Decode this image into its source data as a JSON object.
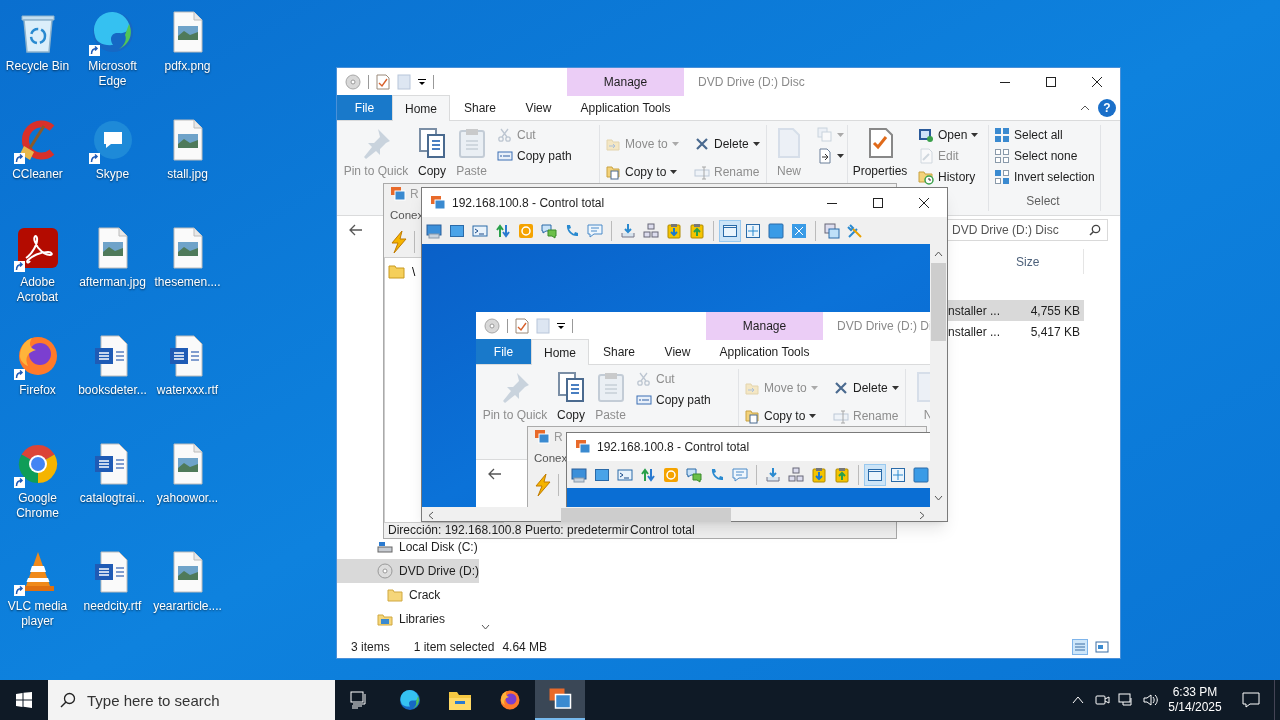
{
  "desktop_icons": [
    {
      "label": "Recycle Bin",
      "kind": "recycle-bin",
      "shortcut": false
    },
    {
      "label": "CCleaner",
      "kind": "ccleaner",
      "shortcut": true
    },
    {
      "label": "Adobe Acrobat",
      "kind": "acrobat",
      "shortcut": true
    },
    {
      "label": "Firefox",
      "kind": "firefox",
      "shortcut": true
    },
    {
      "label": "Google Chrome",
      "kind": "chrome",
      "shortcut": true
    },
    {
      "label": "VLC media player",
      "kind": "vlc",
      "shortcut": true
    },
    {
      "label": "Microsoft Edge",
      "kind": "edge",
      "shortcut": true
    },
    {
      "label": "Skype",
      "kind": "skype",
      "shortcut": true
    },
    {
      "label": "afterman.jpg",
      "kind": "image-file",
      "shortcut": false
    },
    {
      "label": "booksdeter...",
      "kind": "word-file",
      "shortcut": false
    },
    {
      "label": "catalogtrai...",
      "kind": "word-file",
      "shortcut": false
    },
    {
      "label": "needcity.rtf",
      "kind": "word-file",
      "shortcut": false
    },
    {
      "label": "pdfx.png",
      "kind": "image-file",
      "shortcut": false
    },
    {
      "label": "stall.jpg",
      "kind": "image-file",
      "shortcut": false
    },
    {
      "label": "thesemen....",
      "kind": "image-file",
      "shortcut": false
    },
    {
      "label": "waterxxx.rtf",
      "kind": "word-file",
      "shortcut": false
    },
    {
      "label": "yahoowor...",
      "kind": "image-file",
      "shortcut": false
    },
    {
      "label": "yeararticle....",
      "kind": "image-file",
      "shortcut": false
    }
  ],
  "explorer": {
    "context_tab": "Manage",
    "title": "DVD Drive (D:) Disc",
    "tabs": [
      {
        "label": "File",
        "kind": "menu",
        "selected": false
      },
      {
        "label": "Home",
        "kind": "tab",
        "selected": true
      },
      {
        "label": "Share",
        "kind": "tab",
        "selected": false
      },
      {
        "label": "View",
        "kind": "tab",
        "selected": false
      },
      {
        "label": "Application Tools",
        "kind": "tab",
        "selected": false
      }
    ],
    "help": "?",
    "ribbon_groups": [
      {
        "columns": [
          {
            "kind": "large",
            "items": [
              {
                "label": "Pin to Quick",
                "kind": "pin",
                "disabled": true
              }
            ]
          },
          {
            "kind": "large",
            "items": [
              {
                "label": "Copy",
                "kind": "copy",
                "disabled": false
              }
            ]
          },
          {
            "kind": "large",
            "items": [
              {
                "label": "Paste",
                "kind": "paste",
                "disabled": true
              }
            ]
          },
          {
            "kind": "small",
            "items": [
              {
                "label": "Cut",
                "kind": "cut",
                "disabled": true
              },
              {
                "label": "Copy path",
                "kind": "copy-path",
                "disabled": false
              }
            ]
          }
        ]
      },
      {
        "columns": [
          {
            "kind": "medium",
            "items": [
              {
                "label": "Move to",
                "kind": "move-to",
                "disabled": true,
                "dropdown": true
              },
              {
                "label": "Copy to",
                "kind": "copy-to",
                "disabled": false,
                "dropdown": true
              }
            ]
          },
          {
            "kind": "medium",
            "items": [
              {
                "label": "Delete",
                "kind": "delete",
                "disabled": false,
                "dropdown": true
              },
              {
                "label": "Rename",
                "kind": "rename",
                "disabled": true
              }
            ]
          }
        ]
      },
      {
        "columns": [
          {
            "kind": "large",
            "items": [
              {
                "label": "New",
                "kind": "new-folder",
                "disabled": true
              }
            ]
          },
          {
            "kind": "small",
            "items": [
              {
                "kind": "new-item",
                "disabled": true,
                "dropdown": true
              },
              {
                "kind": "easy-access",
                "disabled": false,
                "dropdown": true
              }
            ]
          }
        ]
      },
      {
        "columns": [
          {
            "kind": "large",
            "items": [
              {
                "label": "Properties",
                "kind": "properties",
                "disabled": false
              }
            ]
          },
          {
            "kind": "small",
            "items": [
              {
                "label": "Open",
                "kind": "open",
                "disabled": false,
                "dropdown": true
              },
              {
                "label": "Edit",
                "kind": "edit",
                "disabled": true
              },
              {
                "label": "History",
                "kind": "history",
                "disabled": false
              }
            ]
          }
        ]
      },
      {
        "label": "Select",
        "columns": [
          {
            "kind": "small",
            "items": [
              {
                "label": "Select all",
                "kind": "select-all",
                "disabled": false
              },
              {
                "label": "Select none",
                "kind": "select-none",
                "disabled": false
              },
              {
                "label": "Invert selection",
                "kind": "invert",
                "disabled": false
              }
            ]
          }
        ]
      }
    ],
    "search": "DVD Drive (D:) Disc",
    "columns": [
      "Size"
    ],
    "rows": [
      {
        "cells": [
          "nstaller ...",
          "4,755 KB"
        ],
        "selected": true
      },
      {
        "cells": [
          "nstaller ...",
          "5,417 KB"
        ],
        "selected": false
      }
    ],
    "nav": [
      {
        "label": "Local Disk (C:)",
        "kind": "drive",
        "selected": false
      },
      {
        "label": "DVD Drive (D:)",
        "kind": "disc",
        "selected": true,
        "children": [
          {
            "label": "Crack",
            "kind": "folder",
            "selected": false
          }
        ]
      },
      {
        "label": "Libraries",
        "kind": "library",
        "selected": false
      }
    ],
    "status": [
      "3 items",
      "1 item selected",
      "4.64 MB"
    ]
  },
  "viewer": {
    "title": "R",
    "menu": [
      "Conex"
    ],
    "tree": [
      "\\"
    ],
    "status": [
      "Dirección: 192.168.100.8",
      "Puerto: predetermir",
      "Control total"
    ]
  },
  "control_window": {
    "title": "192.168.100.8 - Control total",
    "toolbar": [
      [
        {
          "kind": "screen",
          "selected": false
        },
        {
          "kind": "window",
          "selected": false
        },
        {
          "kind": "terminal",
          "selected": false
        },
        {
          "kind": "transfer",
          "selected": false
        },
        {
          "kind": "power",
          "selected": false
        },
        {
          "kind": "chat",
          "selected": false
        },
        {
          "kind": "voice",
          "selected": false
        },
        {
          "kind": "message",
          "selected": false
        }
      ],
      [
        {
          "kind": "download",
          "selected": false
        },
        {
          "kind": "network",
          "selected": false
        },
        {
          "kind": "clip-down",
          "selected": false
        },
        {
          "kind": "clip-up",
          "selected": false
        }
      ],
      [
        {
          "kind": "view-normal",
          "selected": true
        },
        {
          "kind": "view-fit",
          "selected": false
        },
        {
          "kind": "view-full",
          "selected": false
        },
        {
          "kind": "view-scale",
          "selected": false
        }
      ],
      [
        {
          "kind": "windows",
          "selected": false
        },
        {
          "kind": "tools",
          "selected": false
        }
      ]
    ],
    "remote_screen": {
      "explorer": {
        "context_tab": "Manage",
        "title": "DVD Drive (D:) Di",
        "tabs": [
          {
            "label": "File",
            "kind": "menu",
            "selected": false
          },
          {
            "label": "Home",
            "kind": "tab",
            "selected": true
          },
          {
            "label": "Share",
            "kind": "tab",
            "selected": false
          },
          {
            "label": "View",
            "kind": "tab",
            "selected": false
          },
          {
            "label": "Application Tools",
            "kind": "tab",
            "selected": false
          }
        ],
        "ribbon_groups": [
          {
            "columns": [
              {
                "kind": "large",
                "items": [
                  {
                    "label": "Pin to Quick",
                    "kind": "pin",
                    "disabled": true
                  }
                ]
              },
              {
                "kind": "large",
                "items": [
                  {
                    "label": "Copy",
                    "kind": "copy",
                    "disabled": false
                  }
                ]
              },
              {
                "kind": "large",
                "items": [
                  {
                    "label": "Paste",
                    "kind": "paste",
                    "disabled": true
                  }
                ]
              },
              {
                "kind": "small",
                "items": [
                  {
                    "label": "Cut",
                    "kind": "cut",
                    "disabled": true
                  },
                  {
                    "label": "Copy path",
                    "kind": "copy-path",
                    "disabled": false
                  }
                ]
              }
            ]
          },
          {
            "columns": [
              {
                "kind": "medium",
                "items": [
                  {
                    "label": "Move to",
                    "kind": "move-to",
                    "disabled": true,
                    "dropdown": true
                  },
                  {
                    "label": "Copy to",
                    "kind": "copy-to",
                    "disabled": false,
                    "dropdown": true
                  }
                ]
              },
              {
                "kind": "medium",
                "items": [
                  {
                    "label": "Delete",
                    "kind": "delete",
                    "disabled": false,
                    "dropdown": true
                  },
                  {
                    "label": "Rename",
                    "kind": "rename",
                    "disabled": true
                  }
                ]
              }
            ]
          },
          {
            "columns": [
              {
                "kind": "large",
                "items": [
                  {
                    "label": "N",
                    "kind": "new-folder",
                    "disabled": true
                  }
                ]
              }
            ]
          }
        ]
      },
      "viewer": {
        "title": "R",
        "menu": [
          "Conex"
        ]
      },
      "control_window": {
        "title": "192.168.100.8 - Control total",
        "toolbar": [
          [
            {
              "kind": "screen",
              "selected": false
            },
            {
              "kind": "window",
              "selected": false
            },
            {
              "kind": "terminal",
              "selected": false
            },
            {
              "kind": "transfer",
              "selected": false
            },
            {
              "kind": "power",
              "selected": false
            },
            {
              "kind": "chat",
              "selected": false
            },
            {
              "kind": "voice",
              "selected": false
            },
            {
              "kind": "message",
              "selected": false
            }
          ],
          [
            {
              "kind": "download",
              "selected": false
            },
            {
              "kind": "network",
              "selected": false
            },
            {
              "kind": "clip-down",
              "selected": false
            },
            {
              "kind": "clip-up",
              "selected": false
            }
          ],
          [
            {
              "kind": "view-normal",
              "selected": true
            },
            {
              "kind": "view-fit",
              "selected": false
            },
            {
              "kind": "view-full",
              "selected": false
            }
          ]
        ]
      }
    }
  },
  "taskbar": {
    "search_placeholder": "Type here to search",
    "apps": [
      {
        "kind": "task-view",
        "active": false
      },
      {
        "kind": "edge",
        "active": false
      },
      {
        "kind": "explorer",
        "active": false
      },
      {
        "kind": "firefox",
        "active": false
      },
      {
        "kind": "radmin",
        "active": true
      }
    ],
    "time": "6:33 PM",
    "date": "5/14/2025"
  }
}
